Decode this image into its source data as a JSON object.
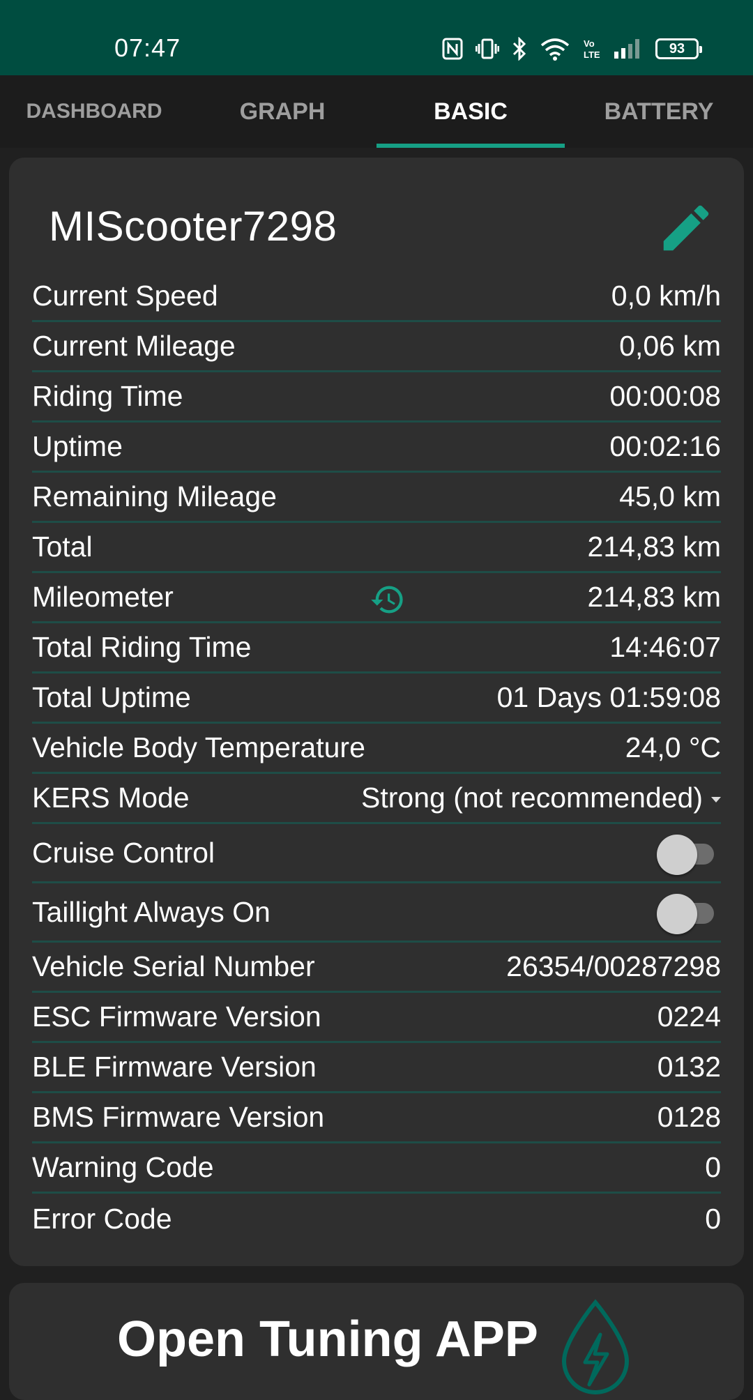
{
  "status_bar": {
    "time": "07:47",
    "battery_level": "93",
    "icons": [
      "nfc-icon",
      "vibrate-icon",
      "bluetooth-icon",
      "wifi-icon",
      "volte-icon",
      "signal-icon",
      "battery-icon"
    ]
  },
  "tabs": [
    {
      "label": "DASHBOARD",
      "active": false
    },
    {
      "label": "GRAPH",
      "active": false
    },
    {
      "label": "BASIC",
      "active": true
    },
    {
      "label": "BATTERY",
      "active": false
    }
  ],
  "card": {
    "title": "MIScooter7298",
    "rows": [
      {
        "label": "Current Speed",
        "value": "0,0 km/h"
      },
      {
        "label": "Current Mileage",
        "value": "0,06 km"
      },
      {
        "label": "Riding Time",
        "value": "00:00:08"
      },
      {
        "label": "Uptime",
        "value": "00:02:16"
      },
      {
        "label": "Remaining Mileage",
        "value": "45,0 km"
      },
      {
        "label": "Total",
        "value": "214,83 km"
      },
      {
        "label": "Mileometer",
        "value": "214,83 km"
      },
      {
        "label": "Total Riding Time",
        "value": "14:46:07"
      },
      {
        "label": "Total Uptime",
        "value": "01 Days 01:59:08"
      },
      {
        "label": "Vehicle Body Temperature",
        "value": "24,0 °C"
      },
      {
        "label": "KERS Mode",
        "value": "Strong (not recommended)"
      },
      {
        "label": "Cruise Control",
        "toggle_on": false
      },
      {
        "label": "Taillight Always On",
        "toggle_on": false
      },
      {
        "label": "Vehicle Serial Number",
        "value": "26354/00287298"
      },
      {
        "label": "ESC Firmware Version",
        "value": "0224"
      },
      {
        "label": "BLE Firmware Version",
        "value": "0132"
      },
      {
        "label": "BMS Firmware Version",
        "value": "0128"
      },
      {
        "label": "Warning Code",
        "value": "0"
      },
      {
        "label": "Error Code",
        "value": "0"
      }
    ]
  },
  "tuning_button": {
    "label": "Open Tuning APP"
  },
  "colors": {
    "status_bar_bg": "#004d40",
    "accent": "#16a085",
    "divider": "#1e4d47",
    "card_bg": "#2f2f2f",
    "page_bg": "#202020"
  }
}
